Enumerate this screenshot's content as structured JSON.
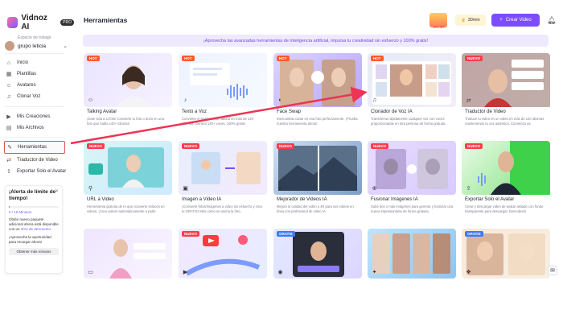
{
  "sidebar": {
    "logo": "Vidnoz AI",
    "pro_badge": "PRO",
    "workspace_label": "Espacio de trabajo",
    "workspace_name": "grupo leticia",
    "nav": [
      {
        "label": "Inicio",
        "icon": "home-icon"
      },
      {
        "label": "Plantillas",
        "icon": "templates-icon"
      },
      {
        "label": "Avatares",
        "icon": "avatar-icon"
      },
      {
        "label": "Clonar Voz",
        "icon": "voice-clone-icon"
      },
      {
        "label": "Mis Creaciones",
        "icon": "creations-icon"
      },
      {
        "label": "Mis Archivos",
        "icon": "files-icon"
      },
      {
        "label": "Herramientas",
        "icon": "tools-icon"
      },
      {
        "label": "Traductor de Video",
        "icon": "translate-icon"
      },
      {
        "label": "Exportar Solo el Avatar",
        "icon": "export-icon"
      }
    ],
    "alert": {
      "title": "¡Alerta de límite de tiempo!",
      "usage": "0 / 15 Minutos",
      "usage_fraction": 0.0,
      "offer_pre": "Obtén nuevo paquete adicional ahora está disponible con un ",
      "offer_highlight": "20% de descuento.",
      "note": "¡Aprovecha la oportunidad para recargar ahora!",
      "button": "Obtener más minutos"
    }
  },
  "header": {
    "title": "Herramientas",
    "promo": "30% OFF",
    "coins": "30min",
    "create_button": "Crear Video"
  },
  "banner": "¡Aprovecha las avanzadas herramientas de inteligencia artificial, impulsa tu creatividad sin esfuerzo y 100% gratis!",
  "cards": [
    {
      "badge": "HOT",
      "title": "Talking Avatar",
      "desc": "¡Dale vida a tu foto! Convierte tu foto o texto en una foto que habla 140+ idiomas."
    },
    {
      "badge": "HOT",
      "title": "Texto a Voz",
      "desc": "Convierte el texto en voz natural en más de 140 idiomas. Genera 140+ voces, 100% gratis!"
    },
    {
      "badge": "HOT",
      "title": "Face Swap",
      "desc": "Intercambia caras en una foto perfectamente. ¡Prueba nuestra herramienta ahora!"
    },
    {
      "badge": "HOT",
      "title": "Clonador de Voz IA",
      "desc": "Transforma rápidamente cualquier voz con voces proporcionadas en otra persona de forma gratuita."
    },
    {
      "badge": "NUEVO",
      "title": "Traductor de Video",
      "desc": "Traduce tu video en un video en más de 140 idiomas manteniendo tu voz auténtica. Comienza ya."
    },
    {
      "badge": "NUEVO",
      "title": "URL a Video",
      "desc": "Herramienta gratuita de IA que convierte enlaces en videos. ¡Crea videos automáticamente a partir."
    },
    {
      "badge": "NUEVO",
      "title": "Imagen a Video IA",
      "desc": "¡Convierte fotos/imágenes a video sin esfuerzo y crea tu GRATIS! Mira cómo se anima la foto."
    },
    {
      "badge": "NUEVO",
      "title": "Mejorador de Videos IA",
      "desc": "Mejora la calidad del video a 4K para sus videos en línea con profesional de video IA."
    },
    {
      "badge": "NUEVO",
      "title": "Fusionar Imágenes IA",
      "desc": "Sube dos o más imágenes para generar y fusionar una nueva impresionante de forma gratuita."
    },
    {
      "badge": "NUEVO",
      "title": "Exportar Solo el Avatar",
      "desc": "Crear y descargar video de avatar aislado con fondo transparente para descargar. Descubrelo"
    },
    {
      "badge": "",
      "title": "",
      "desc": ""
    },
    {
      "badge": "NUEVO",
      "title": "",
      "desc": ""
    },
    {
      "badge": "GRATIS",
      "title": "",
      "desc": ""
    },
    {
      "badge": "",
      "title": "",
      "desc": ""
    },
    {
      "badge": "GRATIS",
      "title": "",
      "desc": ""
    }
  ],
  "colors": {
    "accent": "#7b4dff",
    "banner_bg": "#efe9ff",
    "highlight_border": "#e05252",
    "annotation_arrow": "#ee3355"
  }
}
